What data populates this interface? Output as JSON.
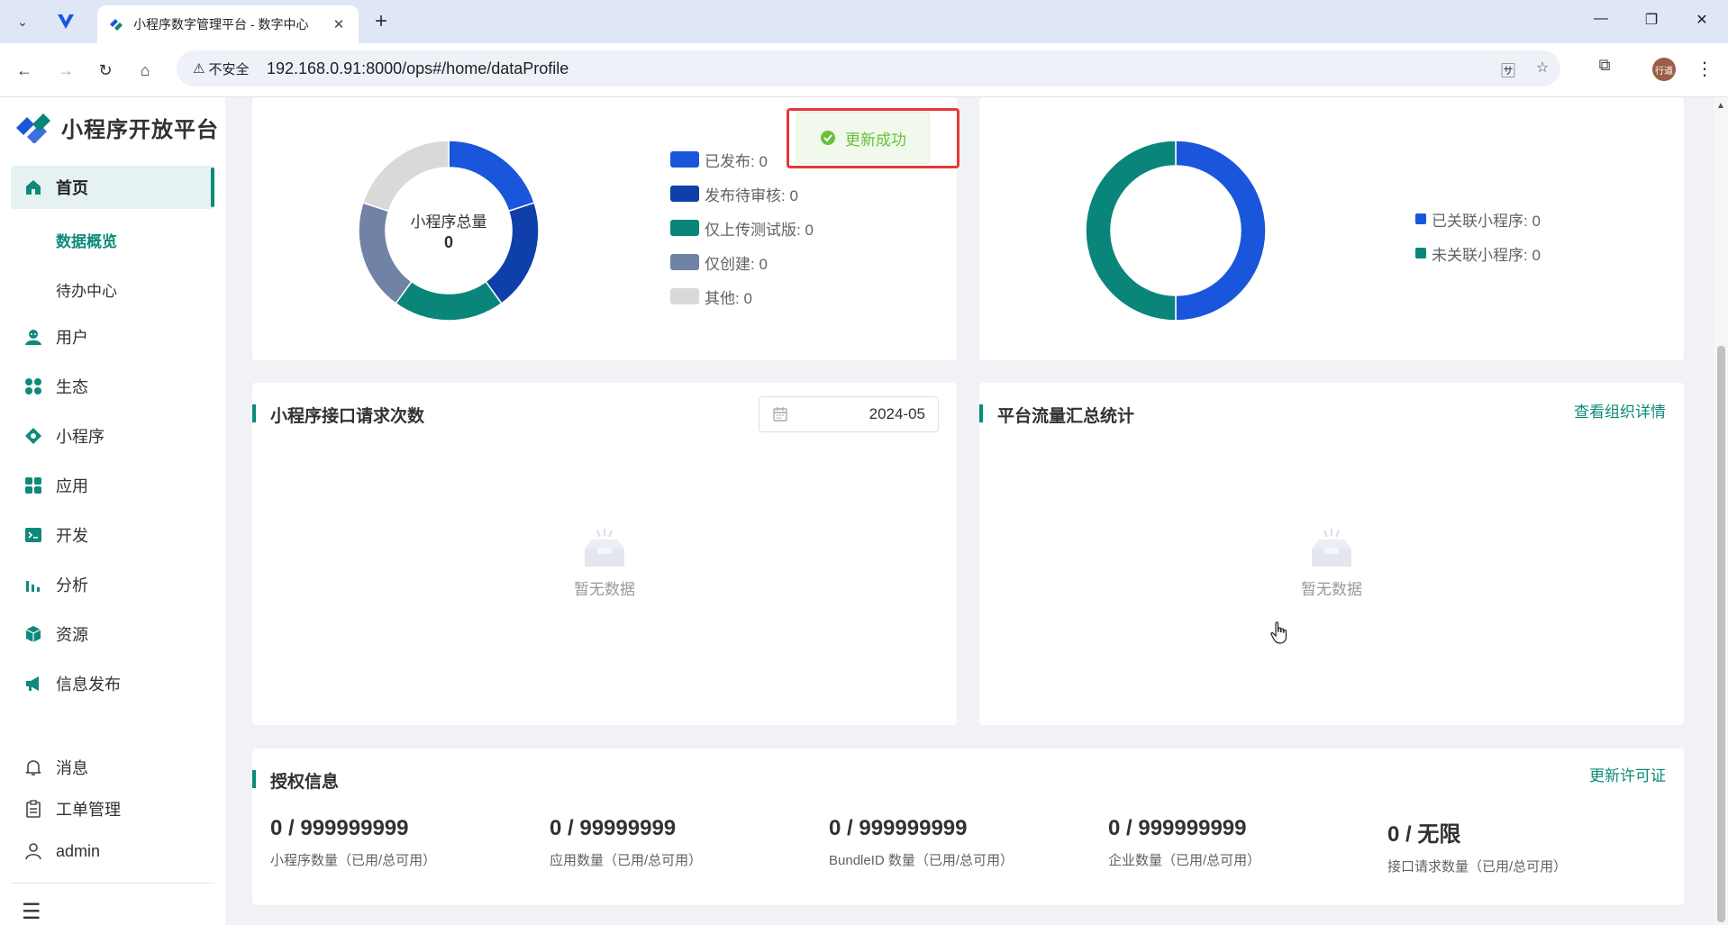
{
  "browser": {
    "tab_title": "小程序数字管理平台 - 数字中心",
    "tab_close": "✕",
    "new_tab": "+",
    "security_label": "不安全",
    "url": "192.168.0.91:8000/ops#/home/dataProfile",
    "profile_text": "行道",
    "window_controls": {
      "minimize": "—",
      "restore": "❐",
      "close": "✕"
    }
  },
  "sidebar": {
    "logo_text": "小程序开放平台",
    "items": [
      {
        "label": "首页",
        "icon": "home-icon"
      },
      {
        "label": "用户",
        "icon": "user-icon"
      },
      {
        "label": "生态",
        "icon": "ecosystem-icon"
      },
      {
        "label": "小程序",
        "icon": "miniprogram-icon"
      },
      {
        "label": "应用",
        "icon": "apps-icon"
      },
      {
        "label": "开发",
        "icon": "terminal-icon"
      },
      {
        "label": "分析",
        "icon": "bar-chart-icon"
      },
      {
        "label": "资源",
        "icon": "cube-icon"
      },
      {
        "label": "信息发布",
        "icon": "megaphone-icon"
      }
    ],
    "sub_items": [
      {
        "label": "数据概览"
      },
      {
        "label": "待办中心"
      }
    ],
    "bottom_items": [
      {
        "label": "消息",
        "icon": "bell-icon"
      },
      {
        "label": "工单管理",
        "icon": "clipboard-icon"
      },
      {
        "label": "admin",
        "icon": "person-icon"
      }
    ]
  },
  "toast": {
    "text": "更新成功"
  },
  "miniprogram_status": {
    "center_label": "小程序总量",
    "center_value": "0",
    "legend": [
      {
        "label": "已发布: 0",
        "color": "#1a56db"
      },
      {
        "label": "发布待审核: 0",
        "color": "#0f3fa8"
      },
      {
        "label": "仅上传测试版: 0",
        "color": "#0a857a"
      },
      {
        "label": "仅创建: 0",
        "color": "#7083a6"
      },
      {
        "label": "其他: 0",
        "color": "#d9d9d9"
      }
    ]
  },
  "association": {
    "legend": [
      {
        "label": "已关联小程序: 0",
        "color": "#1a56db"
      },
      {
        "label": "未关联小程序: 0",
        "color": "#0a857a"
      }
    ]
  },
  "api_requests": {
    "title": "小程序接口请求次数",
    "date": "2024-05",
    "empty_text": "暂无数据"
  },
  "traffic": {
    "title": "平台流量汇总统计",
    "link": "查看组织详情",
    "empty_text": "暂无数据"
  },
  "license": {
    "title": "授权信息",
    "link": "更新许可证",
    "stats": [
      {
        "value": "0 / 999999999",
        "label": "小程序数量（已用/总可用）"
      },
      {
        "value": "0 / 99999999",
        "label": "应用数量（已用/总可用）"
      },
      {
        "value": "0 / 999999999",
        "label": "BundleID 数量（已用/总可用）"
      },
      {
        "value": "0 / 999999999",
        "label": "企业数量（已用/总可用）"
      },
      {
        "value": "0 / 无限",
        "label": "接口请求数量（已用/总可用）"
      }
    ]
  }
}
